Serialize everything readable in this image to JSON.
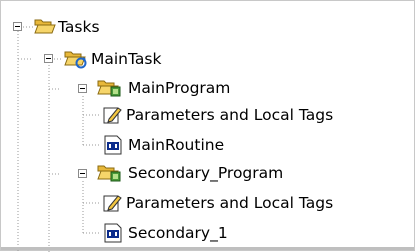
{
  "tree": {
    "tasks_label": "Tasks",
    "main_task_label": "MainTask",
    "main_program_label": "MainProgram",
    "main_program_params_label": "Parameters and Local Tags",
    "main_routine_label": "MainRoutine",
    "secondary_program_label": "Secondary_Program",
    "secondary_program_params_label": "Parameters and Local Tags",
    "secondary_routine_label": "Secondary_1"
  },
  "colors": {
    "folder": "#f2c642",
    "line": "#9a9a9a",
    "routine": "#0b2b8c"
  }
}
